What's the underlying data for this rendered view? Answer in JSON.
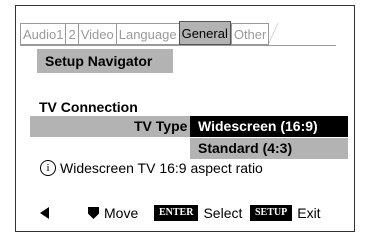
{
  "tabs": [
    {
      "label": "Audio1",
      "active": false
    },
    {
      "label": "2",
      "active": false
    },
    {
      "label": "Video",
      "active": false
    },
    {
      "label": "Language",
      "active": false
    },
    {
      "label": "General",
      "active": true
    },
    {
      "label": "Other",
      "active": false
    }
  ],
  "navigator": {
    "label": "Setup Navigator"
  },
  "section": {
    "heading": "TV Connection"
  },
  "setting": {
    "label": "TV Type",
    "options": [
      "Widescreen (16:9)",
      "Standard (4:3)"
    ],
    "selected": "Widescreen (16:9)"
  },
  "info": {
    "icon": "info-circle-icon",
    "glyph": "i",
    "text": "Widescreen TV 16:9 aspect ratio"
  },
  "footer": {
    "move_label": "Move",
    "enter_key": "ENTER",
    "select_label": "Select",
    "setup_key": "SETUP",
    "exit_label": "Exit"
  },
  "colors": {
    "highlight": "#b3b3b3",
    "selected_bg": "#000000",
    "selected_text": "#ffffff"
  }
}
